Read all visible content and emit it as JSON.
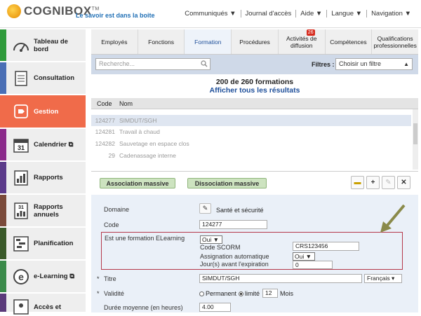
{
  "header": {
    "logo_text": "COGNIBOX",
    "logo_tm": "TM",
    "tagline": "Le savoir est dans la boite",
    "nav": [
      "Communiqués ▼",
      "Journal d'accès",
      "Aide ▼",
      "Langue ▼",
      "Navigation ▼"
    ]
  },
  "sidebar": {
    "items": [
      {
        "label": "Tableau de bord",
        "color": "#2e9a3a",
        "icon": "gauge-icon"
      },
      {
        "label": "Consultation",
        "color": "#4a6fb5",
        "icon": "document-icon"
      },
      {
        "label": "Gestion",
        "color": "#f06b4a",
        "icon": "tag-icon"
      },
      {
        "label": "Calendrier",
        "color": "#8a2a8a",
        "icon": "calendar-icon",
        "icon_text": "31"
      },
      {
        "label": "Rapports",
        "color": "#5b3a8a",
        "icon": "bar-chart-icon"
      },
      {
        "label": "Rapports annuels",
        "color": "#7a4a3a",
        "icon": "annual-report-icon",
        "icon_text": "31"
      },
      {
        "label": "Planification",
        "color": "#3a5a2a",
        "icon": "planning-icon"
      },
      {
        "label": "e-Learning",
        "color": "#3a8a4a",
        "icon": "elearning-icon"
      },
      {
        "label": "Accès et",
        "color": "#5a3a7a",
        "icon": "access-icon"
      }
    ]
  },
  "tabs": [
    {
      "label": "Employés"
    },
    {
      "label": "Fonctions"
    },
    {
      "label": "Formation",
      "active": true
    },
    {
      "label": "Procédures"
    },
    {
      "label": "Activités de diffusion",
      "badge": "26"
    },
    {
      "label": "Compétences"
    },
    {
      "label": "Qualifications professionnelles"
    }
  ],
  "search": {
    "placeholder": "Recherche...",
    "filter_label": "Filtres :",
    "filter_value": "Choisir un filtre"
  },
  "results": {
    "count": "200 de 260 formations",
    "show_all": "Afficher tous les résultats"
  },
  "table": {
    "col_code": "Code",
    "col_nom": "Nom",
    "rows": [
      {
        "code": "",
        "nom": ""
      },
      {
        "code": "124277",
        "nom": "SIMDUT/SGH",
        "selected": true
      },
      {
        "code": "124281",
        "nom": "Travail à chaud"
      },
      {
        "code": "124282",
        "nom": "Sauvetage en espace clos"
      },
      {
        "code": "29",
        "nom": "Cadenassage interne"
      },
      {
        "code": "",
        "nom": ""
      }
    ]
  },
  "actions": {
    "assoc": "Association massive",
    "dissoc": "Dissociation massive"
  },
  "form": {
    "domaine_label": "Domaine",
    "domaine_value": "Santé et sécurité",
    "code_label": "Code",
    "code_value": "124277",
    "elearning_label": "Est une formation ELearning",
    "elearning_value": "Oui",
    "scorm_label": "Code SCORM",
    "scorm_value": "CRS123456",
    "assign_label": "Assignation automatique",
    "assign_value": "Oui",
    "expire_label": "Jour(s) avant l'expiration",
    "expire_value": "0",
    "titre_label": "Titre",
    "titre_value": "SIMDUT/SGH",
    "lang_value": "Français",
    "validite_label": "Validité",
    "validite_opt1": "Permanent",
    "validite_opt2": "limité",
    "validite_num": "12",
    "validite_unit": "Mois",
    "duree_label": "Durée moyenne (en heures)",
    "duree_value": "4.00"
  },
  "colors": {
    "accent": "#1e4f9a",
    "active_nav": "#f06b4a",
    "highlight_box": "#b5384a",
    "annotation_arrow": "#8a8a4a"
  }
}
